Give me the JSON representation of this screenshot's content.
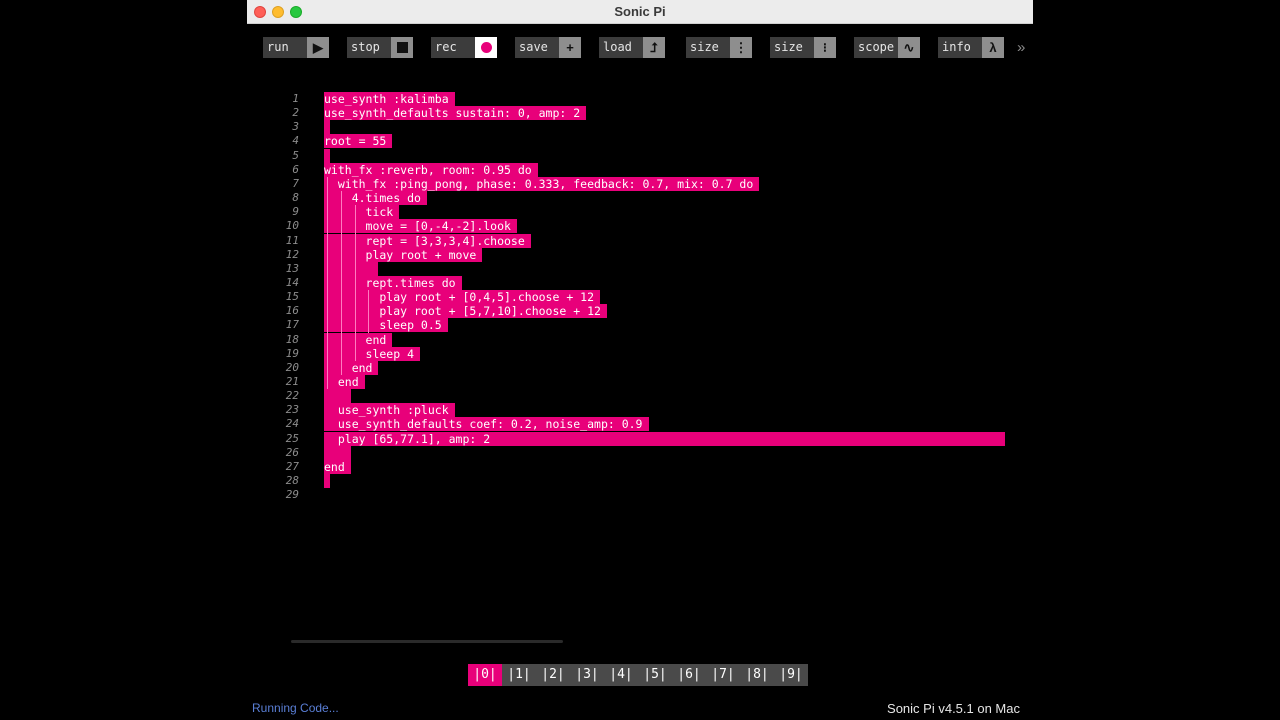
{
  "window": {
    "title": "Sonic Pi"
  },
  "toolbar": {
    "run_label": "run",
    "stop_label": "stop",
    "rec_label": "rec",
    "save_label": "save",
    "load_label": "load",
    "size_down_label": "size",
    "size_up_label": "size",
    "scope_label": "scope",
    "info_label": "info",
    "more_glyph": "»",
    "play_glyph": "▶",
    "plus_glyph": "+",
    "load_glyph": "⮥",
    "size_down_glyph": "⋮",
    "size_up_glyph": "⁝",
    "scope_glyph": "∿",
    "info_glyph": "λ"
  },
  "editor": {
    "lines": [
      {
        "n": "1",
        "text": "use_synth :kalimba"
      },
      {
        "n": "2",
        "text": "use_synth_defaults sustain: 0, amp: 2"
      },
      {
        "n": "3",
        "text": ""
      },
      {
        "n": "4",
        "text": "root = 55"
      },
      {
        "n": "5",
        "text": ""
      },
      {
        "n": "6",
        "text": "with_fx :reverb, room: 0.95 do"
      },
      {
        "n": "7",
        "text": "  with_fx :ping_pong, phase: 0.333, feedback: 0.7, mix: 0.7 do"
      },
      {
        "n": "8",
        "text": "    4.times do"
      },
      {
        "n": "9",
        "text": "      tick"
      },
      {
        "n": "10",
        "text": "      move = [0,-4,-2].look"
      },
      {
        "n": "11",
        "text": "      rept = [3,3,3,4].choose"
      },
      {
        "n": "12",
        "text": "      play root + move"
      },
      {
        "n": "13",
        "text": "       "
      },
      {
        "n": "14",
        "text": "      rept.times do"
      },
      {
        "n": "15",
        "text": "        play root + [0,4,5].choose + 12"
      },
      {
        "n": "16",
        "text": "        play root + [5,7,10].choose + 12"
      },
      {
        "n": "17",
        "text": "        sleep 0.5"
      },
      {
        "n": "18",
        "text": "      end"
      },
      {
        "n": "19",
        "text": "      sleep 4"
      },
      {
        "n": "20",
        "text": "    end"
      },
      {
        "n": "21",
        "text": "  end"
      },
      {
        "n": "22",
        "text": "   "
      },
      {
        "n": "23",
        "text": "  use_synth :pluck"
      },
      {
        "n": "24",
        "text": "  use_synth_defaults coef: 0.2, noise_amp: 0.9"
      },
      {
        "n": "25",
        "text": "  play [65,77.1], amp: 2"
      },
      {
        "n": "26",
        "text": "   "
      },
      {
        "n": "27",
        "text": "end"
      },
      {
        "n": "28",
        "text": ""
      },
      {
        "n": "29",
        "text": null
      }
    ]
  },
  "buffers": [
    "|0|",
    "|1|",
    "|2|",
    "|3|",
    "|4|",
    "|5|",
    "|6|",
    "|7|",
    "|8|",
    "|9|"
  ],
  "active_buffer": 0,
  "status": {
    "left": "Running Code...",
    "right": "Sonic Pi v4.5.1 on Mac"
  },
  "colors": {
    "accent": "#e8007a",
    "status_link": "#5a7fd6"
  }
}
